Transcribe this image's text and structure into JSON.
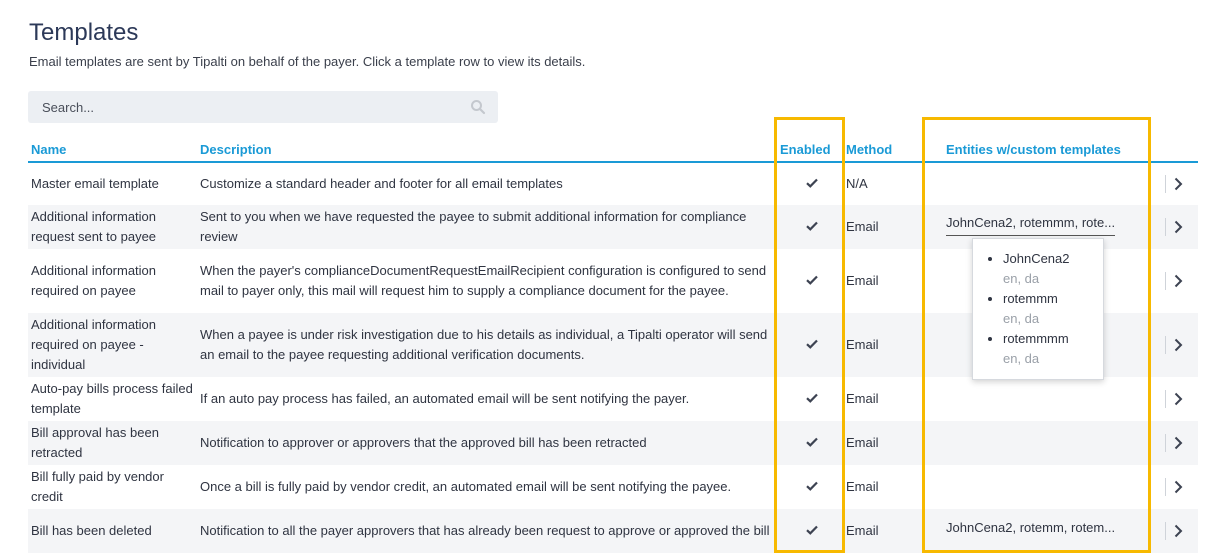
{
  "page": {
    "title": "Templates",
    "subtitle": "Email templates are sent by Tipalti on behalf of the payer. Click a template row to view its details."
  },
  "search": {
    "placeholder": "Search..."
  },
  "columns": {
    "name": "Name",
    "description": "Description",
    "enabled": "Enabled",
    "method": "Method",
    "entities": "Entities w/custom templates"
  },
  "rows": [
    {
      "name": "Master email template",
      "description": "Customize a standard header and footer for all email templates",
      "enabled": true,
      "method": "N/A",
      "entities": ""
    },
    {
      "name": "Additional information request sent to payee",
      "description": "Sent to you when we have requested the payee to submit additional information for compliance review",
      "enabled": true,
      "method": "Email",
      "entities": "JohnCena2, rotemmm, rote..."
    },
    {
      "name": "Additional information required on payee",
      "description": "When the payer's complianceDocumentRequestEmailRecipient configuration is configured to send mail to payer only, this mail will request him to supply a compliance document for the payee.",
      "enabled": true,
      "method": "Email",
      "entities": ""
    },
    {
      "name": "Additional information required on payee - individual",
      "description": "When a payee is under risk investigation due to his details as individual, a Tipalti operator will send an email to the payee requesting additional verification documents.",
      "enabled": true,
      "method": "Email",
      "entities": ""
    },
    {
      "name": "Auto-pay bills process failed template",
      "description": "If an auto pay process has failed, an automated email will be sent notifying the payer.",
      "enabled": true,
      "method": "Email",
      "entities": ""
    },
    {
      "name": "Bill approval has been retracted",
      "description": "Notification to approver or approvers that the approved bill has been retracted",
      "enabled": true,
      "method": "Email",
      "entities": ""
    },
    {
      "name": "Bill fully paid by vendor credit",
      "description": "Once a bill is fully paid by vendor credit, an automated email will be sent notifying the payee.",
      "enabled": true,
      "method": "Email",
      "entities": ""
    },
    {
      "name": "Bill has been deleted",
      "description": "Notification to all the payer approvers that has already been request to approve or approved the bill",
      "enabled": true,
      "method": "Email",
      "entities": "JohnCena2, rotemm, rotem..."
    }
  ],
  "popup": {
    "items": [
      {
        "entity": "JohnCena2",
        "langs": "en, da"
      },
      {
        "entity": "rotemmm",
        "langs": "en, da"
      },
      {
        "entity": "rotemmmm",
        "langs": "en, da"
      }
    ]
  },
  "colors": {
    "accent": "#1a9ad6",
    "highlight": "#f7b900",
    "title": "#2c3958"
  },
  "icons": {
    "search": "search-icon",
    "enabled": "checkmark-icon",
    "row_open": "chevron-right-icon"
  }
}
